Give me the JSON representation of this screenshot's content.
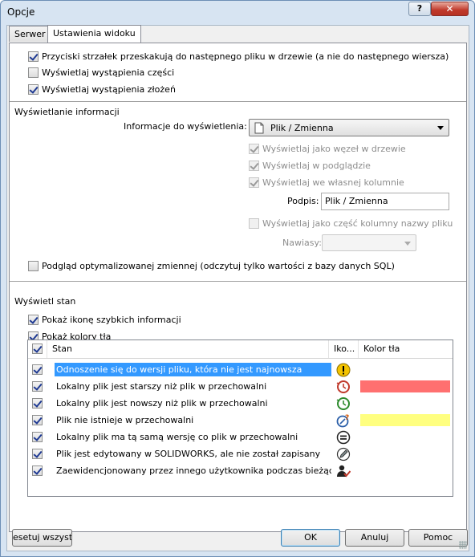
{
  "window": {
    "title": "Opcje",
    "help_label": "?",
    "close_label": "✕"
  },
  "tabs": [
    {
      "label": "Serwer",
      "active": false
    },
    {
      "label": "Ustawienia widoku",
      "active": true
    }
  ],
  "tree_options": [
    {
      "label": "Przyciski strzałek przeskakują do następnego pliku w drzewie (a nie do następnego wiersza)",
      "checked": true
    },
    {
      "label": "Wyświetlaj wystąpienia części",
      "checked": false
    },
    {
      "label": "Wyświetlaj wystąpienia złożeń",
      "checked": true
    }
  ],
  "display_info": {
    "section_title": "Wyświetlanie informacji",
    "info_label": "Informacje do wyświetlenia:",
    "info_value": "Plik / Zmienna",
    "info_icon": "document-icon",
    "opt_node": {
      "label": "Wyświetlaj jako węzeł w drzewie",
      "checked": true,
      "disabled": true
    },
    "opt_preview": {
      "label": "Wyświetlaj w podglądzie",
      "checked": true,
      "disabled": true
    },
    "opt_column": {
      "label": "Wyświetlaj we własnej kolumnie",
      "checked": true,
      "disabled": true
    },
    "caption_label": "Podpis:",
    "caption_value": "Plik / Zmienna",
    "opt_filename": {
      "label": "Wyświetlaj jako część kolumny nazwy pliku",
      "checked": false,
      "disabled": true
    },
    "brackets_label": "Nawiasy:",
    "brackets_value": "",
    "opt_optimized": {
      "label": "Podgląd optymalizowanej zmiennej (odczytuj tylko wartości z bazy danych SQL)",
      "checked": false
    }
  },
  "status": {
    "section_title": "Wyświetl stan",
    "opt_quickinfo": {
      "label": "Pokaż ikonę szybkich informacji",
      "checked": true
    },
    "opt_bgcolors": {
      "label": "Pokaż kolory tła",
      "checked": true
    },
    "columns": {
      "state": "Stan",
      "icon": "Iko...",
      "bg_color": "Kolor tła"
    },
    "header_checked": true,
    "rows": [
      {
        "label": "Odnoszenie się do wersji pliku, która nie jest najnowsza",
        "checked": true,
        "selected": true,
        "icon": "warning-icon",
        "color": ""
      },
      {
        "label": "Lokalny plik jest starszy niż plik w przechowalni",
        "checked": true,
        "selected": false,
        "icon": "clock-older-icon",
        "color": "#ff7070"
      },
      {
        "label": "Lokalny plik jest nowszy niż plik w przechowalni",
        "checked": true,
        "selected": false,
        "icon": "clock-newer-icon",
        "color": ""
      },
      {
        "label": "Plik nie istnieje w przechowalni",
        "checked": true,
        "selected": false,
        "icon": "missing-file-icon",
        "color": "#ffff80"
      },
      {
        "label": "Lokalny plik ma tą samą wersję co plik w przechowalni",
        "checked": true,
        "selected": false,
        "icon": "equal-icon",
        "color": ""
      },
      {
        "label": "Plik jest edytowany w SOLIDWORKS, ale nie został zapisany",
        "checked": true,
        "selected": false,
        "icon": "pencil-icon",
        "color": ""
      },
      {
        "label": "Zaewidencjonowany przez innego użytkownika podczas bieżąc...",
        "checked": true,
        "selected": false,
        "icon": "user-check-icon",
        "color": ""
      }
    ]
  },
  "buttons": {
    "reset": "esetuj wszystk",
    "ok": "OK",
    "cancel": "Anuluj",
    "help": "Pomoc"
  },
  "colors": {
    "selection": "#3399ff",
    "row_red": "#ff7070",
    "row_yellow": "#ffff80"
  }
}
